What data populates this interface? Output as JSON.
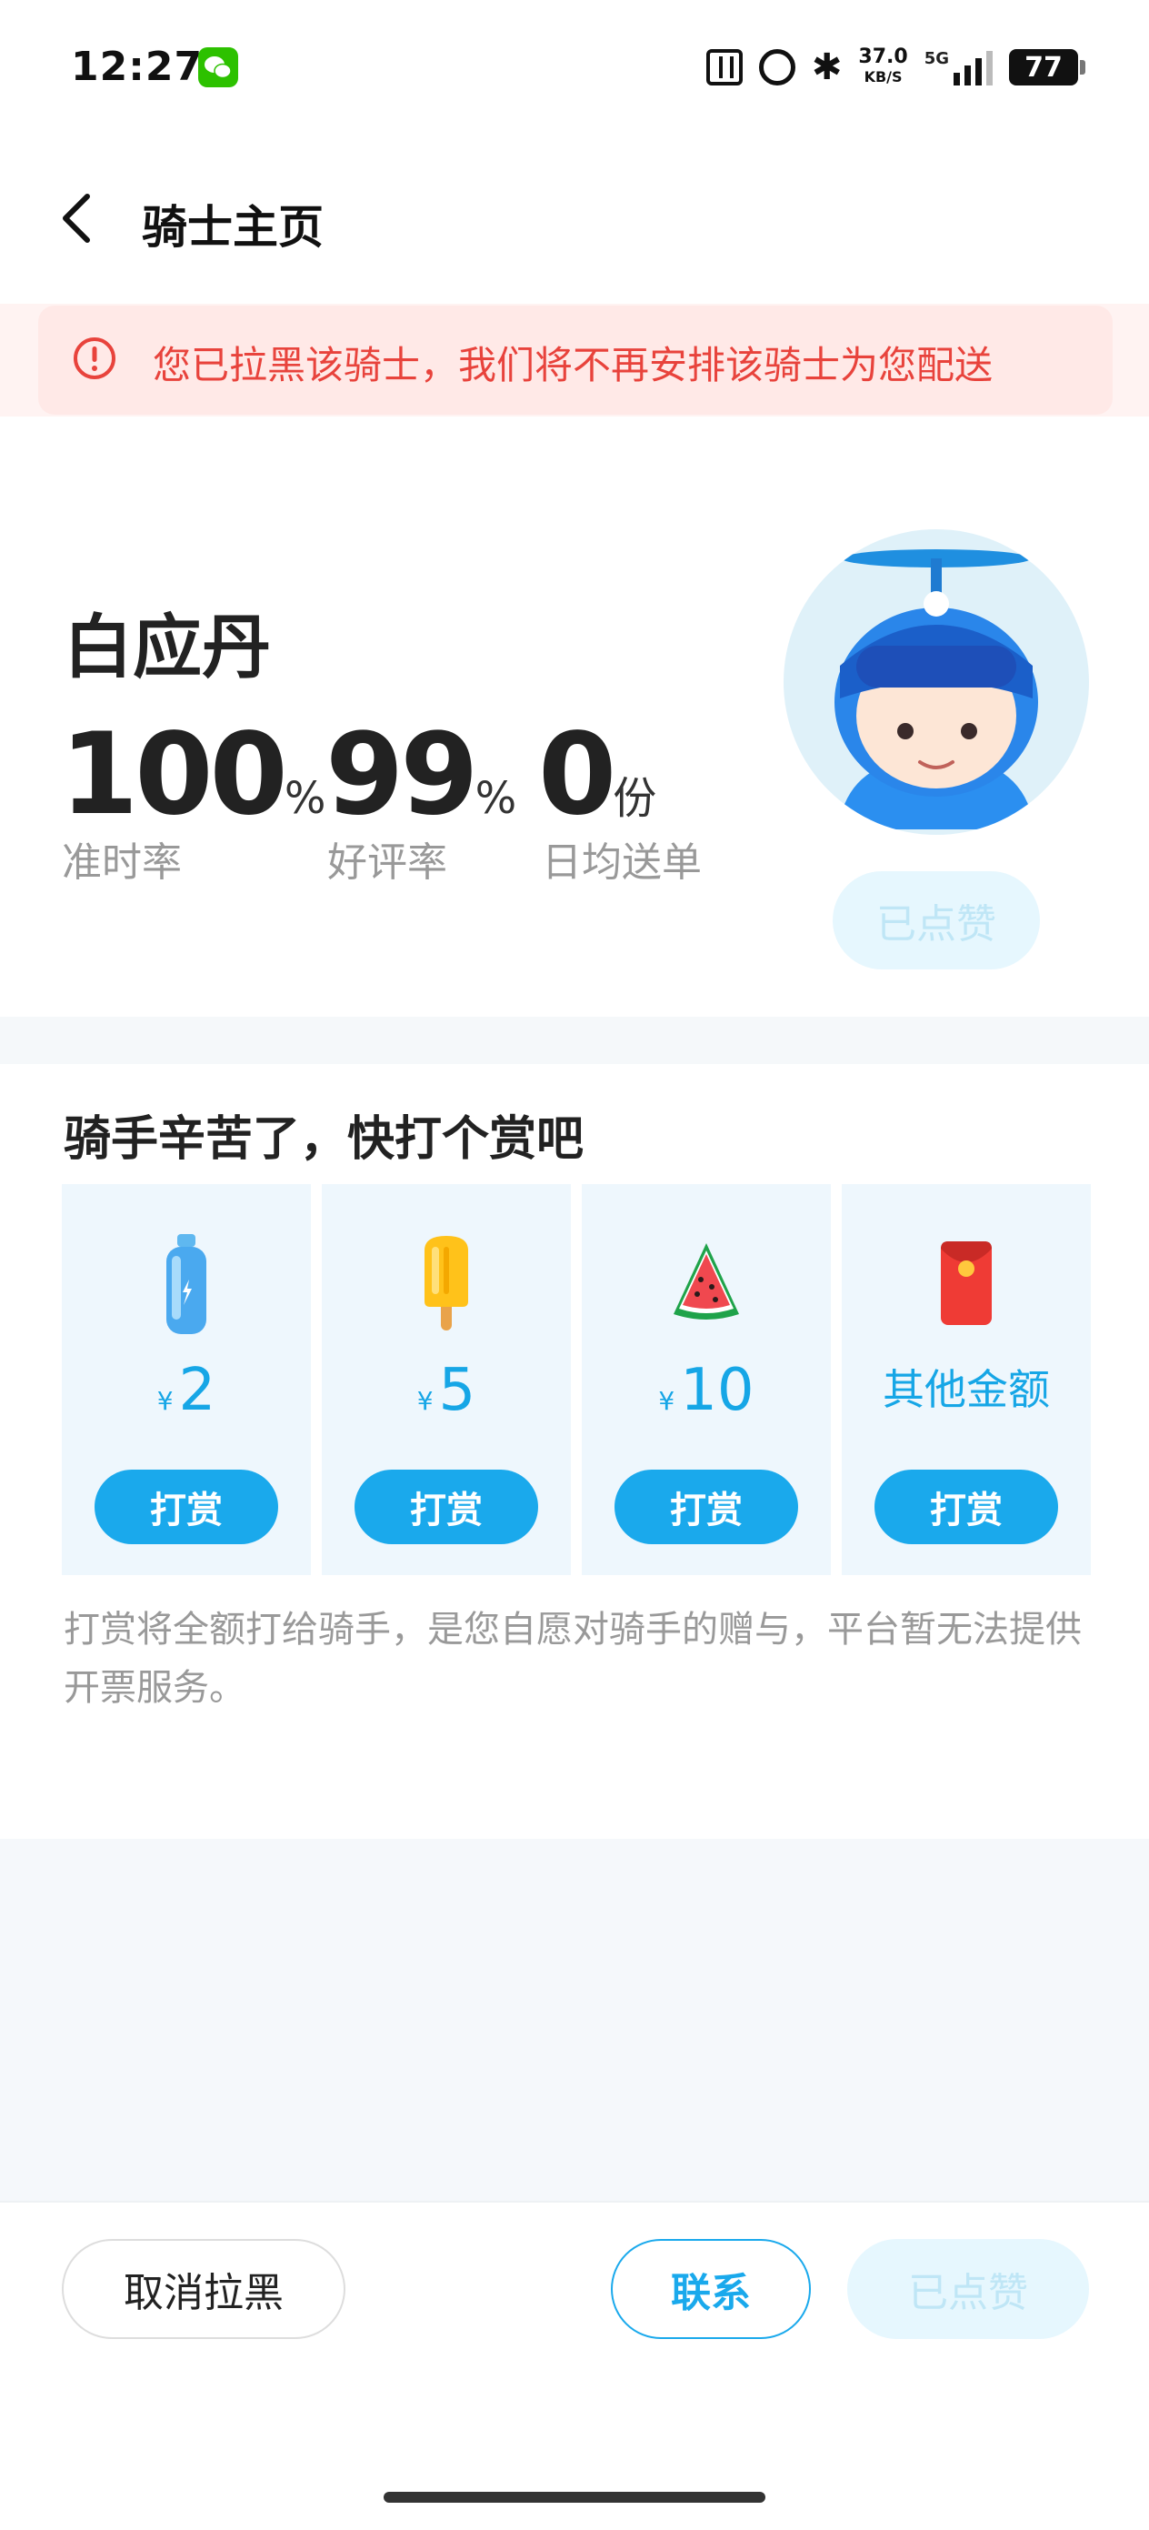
{
  "status_bar": {
    "time": "12:27",
    "speed_value": "37.0",
    "speed_unit": "KB/S",
    "network": "5G",
    "battery": "77",
    "icons": [
      "wechat-icon",
      "nfc-icon",
      "alarm-icon",
      "bluetooth-icon",
      "signal-icon",
      "battery-icon"
    ]
  },
  "header": {
    "title": "骑士主页"
  },
  "banner": {
    "text": "您已拉黑该骑士，我们将不再安排该骑士为您配送",
    "color": "#e8433c"
  },
  "rider": {
    "name": "白应丹",
    "stats": [
      {
        "value": "100",
        "unit": "%",
        "label": "准时率"
      },
      {
        "value": "99",
        "unit": "%",
        "label": "好评率"
      },
      {
        "value": "0",
        "unit": "份",
        "label": "日均送单"
      }
    ],
    "liked_label": "已点赞"
  },
  "tip": {
    "title": "骑手辛苦了，快打个赏吧",
    "currency": "¥",
    "options": [
      {
        "icon": "water-bottle-icon",
        "amount": "2",
        "button": "打赏"
      },
      {
        "icon": "popsicle-icon",
        "amount": "5",
        "button": "打赏"
      },
      {
        "icon": "watermelon-icon",
        "amount": "10",
        "button": "打赏"
      },
      {
        "icon": "red-envelope-icon",
        "label": "其他金额",
        "button": "打赏"
      }
    ],
    "note": "打赏将全额打给骑手，是您自愿对骑手的赠与，平台暂无法提供开票服务。"
  },
  "bottom": {
    "unblock_label": "取消拉黑",
    "contact_label": "联系",
    "liked_label": "已点赞"
  },
  "colors": {
    "accent": "#1aa9ec",
    "warning": "#e8433c"
  }
}
